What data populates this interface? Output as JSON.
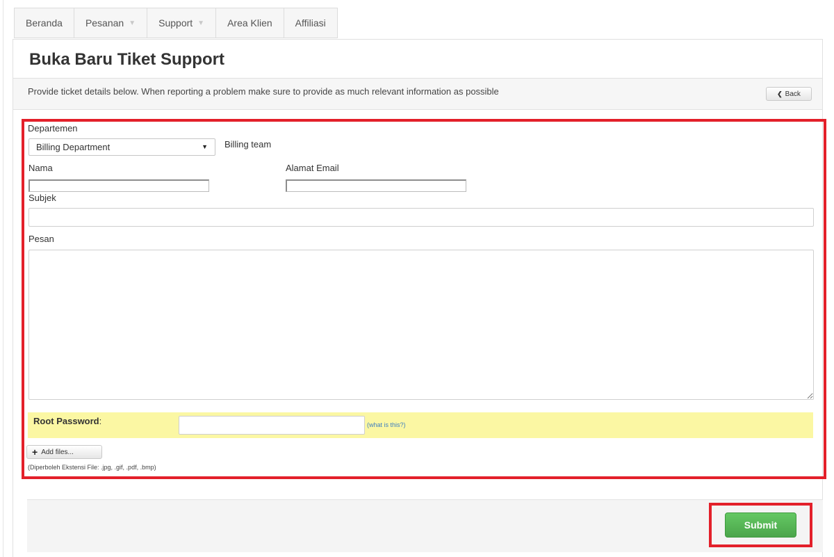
{
  "nav": {
    "items": [
      {
        "label": "Beranda",
        "dropdown": false
      },
      {
        "label": "Pesanan",
        "dropdown": true
      },
      {
        "label": "Support",
        "dropdown": true
      },
      {
        "label": "Area Klien",
        "dropdown": false
      },
      {
        "label": "Affiliasi",
        "dropdown": false
      }
    ]
  },
  "page": {
    "title": "Buka Baru Tiket Support",
    "info": "Provide ticket details below. When reporting a problem make sure to provide as much relevant information as possible",
    "back_label": "Back"
  },
  "form": {
    "department": {
      "label": "Departemen",
      "selected": "Billing Department",
      "description": "Billing team"
    },
    "name": {
      "label": "Nama",
      "value": ""
    },
    "email": {
      "label": "Alamat Email",
      "value": ""
    },
    "subject": {
      "label": "Subjek",
      "value": ""
    },
    "message": {
      "label": "Pesan",
      "value": ""
    },
    "root_password": {
      "label": "Root Password",
      "label_suffix": ":",
      "value": "",
      "help_link": "(what is this?)",
      "highlight_color": "#fbf7a3"
    },
    "add_files_label": "Add files...",
    "allowed_extensions": "(Diperboleh Ekstensi File: .jpg, .gif, .pdf, .bmp)"
  },
  "submit_label": "Submit",
  "colors": {
    "highlight_outline": "#e3202a",
    "submit_green": "#57b657",
    "link_blue": "#3f7fc0"
  },
  "icons": [
    "chevron-left-icon",
    "chevron-down-icon",
    "plus-icon",
    "resize-handle-icon"
  ]
}
